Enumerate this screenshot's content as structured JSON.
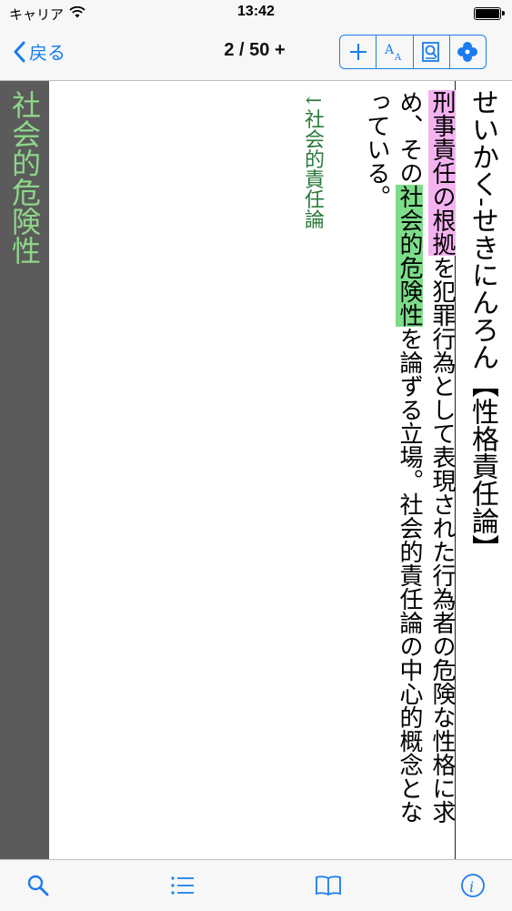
{
  "status_bar": {
    "carrier": "キャリア",
    "time": "13:42"
  },
  "nav": {
    "back_label": "戻る",
    "page_counter": "2 / 50 +",
    "tools": [
      "plus-icon",
      "text-size-icon",
      "search-document-icon",
      "clover-menu-icon"
    ]
  },
  "sidebar": {
    "title": "社会的危険性"
  },
  "entry": {
    "headword": "せいかく‐せきにんろん【性格責任論】",
    "body": {
      "highlight_1": "刑事責任の根拠",
      "text_1": "を犯罪行為として表現された行為者の危険な性格に求め、その",
      "highlight_2": "社会的危険性",
      "text_2": "を論ずる立場。社会的責任論の中心的概念となっている。"
    },
    "crossref": "↓社会的責任論"
  },
  "colors": {
    "accent": "#1a7cf0",
    "pink_highlight": "#f4b3f0",
    "green_highlight": "#7ddd8a",
    "sidebar_bg": "#5b5b5b",
    "sidebar_text": "#8ed68a"
  },
  "tab_bar": [
    "search-icon",
    "list-icon",
    "book-icon",
    "info-icon"
  ]
}
